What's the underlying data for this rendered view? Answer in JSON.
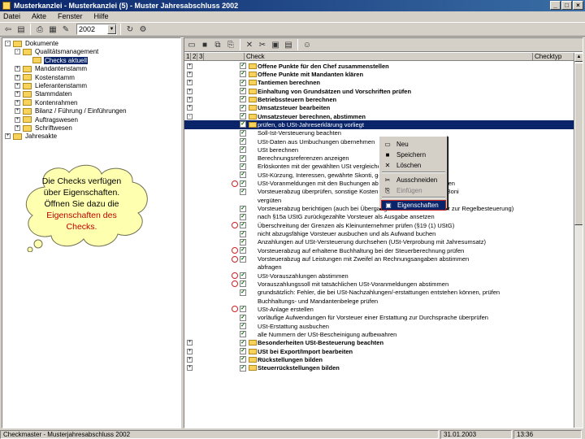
{
  "window": {
    "title": "Musterkanzlei - Musterkanzlei (5) - Muster Jahresabschluss 2002"
  },
  "menubar": [
    "Datei",
    "Akte",
    "Fenster",
    "Hilfe"
  ],
  "toolbar": {
    "year": "2002"
  },
  "tree": [
    {
      "label": "Dokumente",
      "level": 0,
      "toggle": "-"
    },
    {
      "label": "Qualitätsmanagement",
      "level": 1,
      "toggle": "-"
    },
    {
      "label": "Checks aktuell",
      "level": 2,
      "toggle": "",
      "selected": true
    },
    {
      "label": "Mandantenstamm",
      "level": 1,
      "toggle": "+"
    },
    {
      "label": "Kostenstamm",
      "level": 1,
      "toggle": "+"
    },
    {
      "label": "Lieferantenstamm",
      "level": 1,
      "toggle": "+"
    },
    {
      "label": "Stammdaten",
      "level": 1,
      "toggle": "+"
    },
    {
      "label": "Kontenrahmen",
      "level": 1,
      "toggle": "+"
    },
    {
      "label": "Bilanz / Führung / Einführungen",
      "level": 1,
      "toggle": "+"
    },
    {
      "label": "Auftragswesen",
      "level": 1,
      "toggle": "+"
    },
    {
      "label": "Schriftwesen",
      "level": 1,
      "toggle": "+"
    },
    {
      "label": "Jahresakte",
      "level": 0,
      "toggle": "+"
    }
  ],
  "columns": {
    "check": "Check",
    "checktyp": "Checktyp"
  },
  "rows": [
    {
      "text": "Offene Punkte für den Chef zusammenstellen",
      "bold": true,
      "folder": true,
      "exp": "+"
    },
    {
      "text": "Offene Punkte mit Mandanten klären",
      "bold": true,
      "folder": true,
      "exp": "+"
    },
    {
      "text": "Tantiemen berechnen",
      "bold": true,
      "folder": true,
      "exp": "+"
    },
    {
      "text": "Einhaltung von Grundsätzen und Vorschriften prüfen",
      "bold": true,
      "folder": true,
      "exp": "+"
    },
    {
      "text": "Betriebssteuern berechnen",
      "bold": true,
      "folder": true,
      "exp": "+"
    },
    {
      "text": "Umsatzsteuer bearbeiten",
      "bold": true,
      "folder": true,
      "exp": "+"
    },
    {
      "text": "Umsatzsteuer berechnen, abstimmen",
      "bold": true,
      "folder": true,
      "exp": "-"
    },
    {
      "text": "prüfen, ob USt-Jahreserklärung vorliegt",
      "bold": false,
      "folder": true,
      "exp": "",
      "highlight": true
    },
    {
      "text": "Soll-Ist-Versteuerung beachten",
      "bold": false,
      "folder": false,
      "exp": ""
    },
    {
      "text": "USt-Daten aus Umbuchungen übernehmen",
      "bold": false,
      "folder": false,
      "exp": ""
    },
    {
      "text": "USt berechnen",
      "bold": false,
      "folder": false,
      "exp": ""
    },
    {
      "text": "Berechnungsreferenzen anzeigen",
      "bold": false,
      "folder": false,
      "exp": ""
    },
    {
      "text": "Erlöskonten mit der gewählten USt vergleichen",
      "bold": false,
      "folder": false,
      "exp": ""
    },
    {
      "text": "USt-Kürzung, Interessen, gewährte Skonti, gewährte Boni",
      "bold": false,
      "folder": false,
      "exp": ""
    },
    {
      "text": "USt-Voranmeldungen mit den Buchungen abstimmen, Differenzen prüfen",
      "bold": false,
      "folder": false,
      "exp": "",
      "red": true
    },
    {
      "text": "Vorsteuerabzug überprüfen, sonstige Kosten mit Vorsteuer, Erhaltene Boni",
      "bold": false,
      "folder": false,
      "exp": ""
    },
    {
      "text": "vergüten",
      "bold": false,
      "folder": false,
      "exp": "",
      "nochk": true
    },
    {
      "text": "Vorsteuerabzug berichtigen (auch bei Übergang vom Kleinunternehmer zur Regelbesteuerung)",
      "bold": false,
      "folder": false,
      "exp": ""
    },
    {
      "text": "nach §15a UStG zurückgezahlte Vorsteuer als Ausgabe ansetzen",
      "bold": false,
      "folder": false,
      "exp": ""
    },
    {
      "text": "Überschreitung der Grenzen als Kleinunternehmer prüfen (§19 (1) UStG)",
      "bold": false,
      "folder": false,
      "exp": "",
      "red": true
    },
    {
      "text": "nicht abzugsfähige Vorsteuer ausbuchen und als Aufwand buchen",
      "bold": false,
      "folder": false,
      "exp": ""
    },
    {
      "text": "Anzahlungen auf USt-Versteuerung durchsehen (USt-Verprobung mit Jahresumsatz)",
      "bold": false,
      "folder": false,
      "exp": ""
    },
    {
      "text": "Vorsteuerabzug auf erhaltene Buchhaltung bei der Steuerberechnung prüfen",
      "bold": false,
      "folder": false,
      "exp": "",
      "red": true
    },
    {
      "text": "Vorsteuerabzug auf Leistungen mit Zweifel an Rechnungsangaben abstimmen",
      "bold": false,
      "folder": false,
      "exp": "",
      "red": true
    },
    {
      "text": "abfragen",
      "bold": false,
      "folder": false,
      "exp": "",
      "nochk": true
    },
    {
      "text": "USt-Vorauszahlungen abstimmen",
      "bold": false,
      "folder": false,
      "exp": "",
      "red": true
    },
    {
      "text": "Vorauszahlungssoll mit tatsächlichen USt-Voranmeldungen abstimmen",
      "bold": false,
      "folder": false,
      "exp": "",
      "red": true
    },
    {
      "text": "grundsätzlich: Fehler, die bei USt-Nachzahlungen/-erstattungen entstehen können, prüfen",
      "bold": false,
      "folder": false,
      "exp": ""
    },
    {
      "text": "Buchhaltungs- und Mandantenbelege prüfen",
      "bold": false,
      "folder": false,
      "exp": "",
      "nochk": true
    },
    {
      "text": "USt-Anlage erstellen",
      "bold": false,
      "folder": false,
      "exp": "",
      "red": true
    },
    {
      "text": "vorläufige Aufwendungen für Vorsteuer einer Erstattung zur Durchsprache überprüfen",
      "bold": false,
      "folder": false,
      "exp": ""
    },
    {
      "text": "USt-Erstattung ausbuchen",
      "bold": false,
      "folder": false,
      "exp": ""
    },
    {
      "text": "alle Nummern der USt-Bescheinigung aufbewahren",
      "bold": false,
      "folder": false,
      "exp": ""
    },
    {
      "text": "Besonderheiten USt-Besteuerung beachten",
      "bold": true,
      "folder": true,
      "exp": "+"
    },
    {
      "text": "USt bei Export/Import bearbeiten",
      "bold": true,
      "folder": true,
      "exp": "+"
    },
    {
      "text": "Rückstellungen bilden",
      "bold": true,
      "folder": true,
      "exp": "+"
    },
    {
      "text": "Steuerrückstellungen bilden",
      "bold": true,
      "folder": true,
      "exp": "+"
    }
  ],
  "context_menu": [
    {
      "label": "Neu",
      "icon": "new-icon",
      "disabled": false
    },
    {
      "label": "Speichern",
      "icon": "save-icon",
      "disabled": false
    },
    {
      "label": "Löschen",
      "icon": "delete-icon",
      "disabled": false
    },
    {
      "sep": true
    },
    {
      "label": "Ausschneiden",
      "icon": "cut-icon",
      "disabled": false
    },
    {
      "label": "Einfügen",
      "icon": "paste-icon",
      "disabled": true
    },
    {
      "sep": true
    },
    {
      "label": "Eigenschaften",
      "icon": "properties-icon",
      "disabled": false,
      "active": true
    }
  ],
  "callout": {
    "line1": "Die Checks verfügen",
    "line2": "über Eigenschaften.",
    "line3": "Öffnen Sie dazu die",
    "line4": "Eigenschaften des",
    "line5": "Checks."
  },
  "status": {
    "left": "Checkmaster - Musterjahresabschluss 2002",
    "date": "31.01.2003",
    "time": "13:36"
  }
}
